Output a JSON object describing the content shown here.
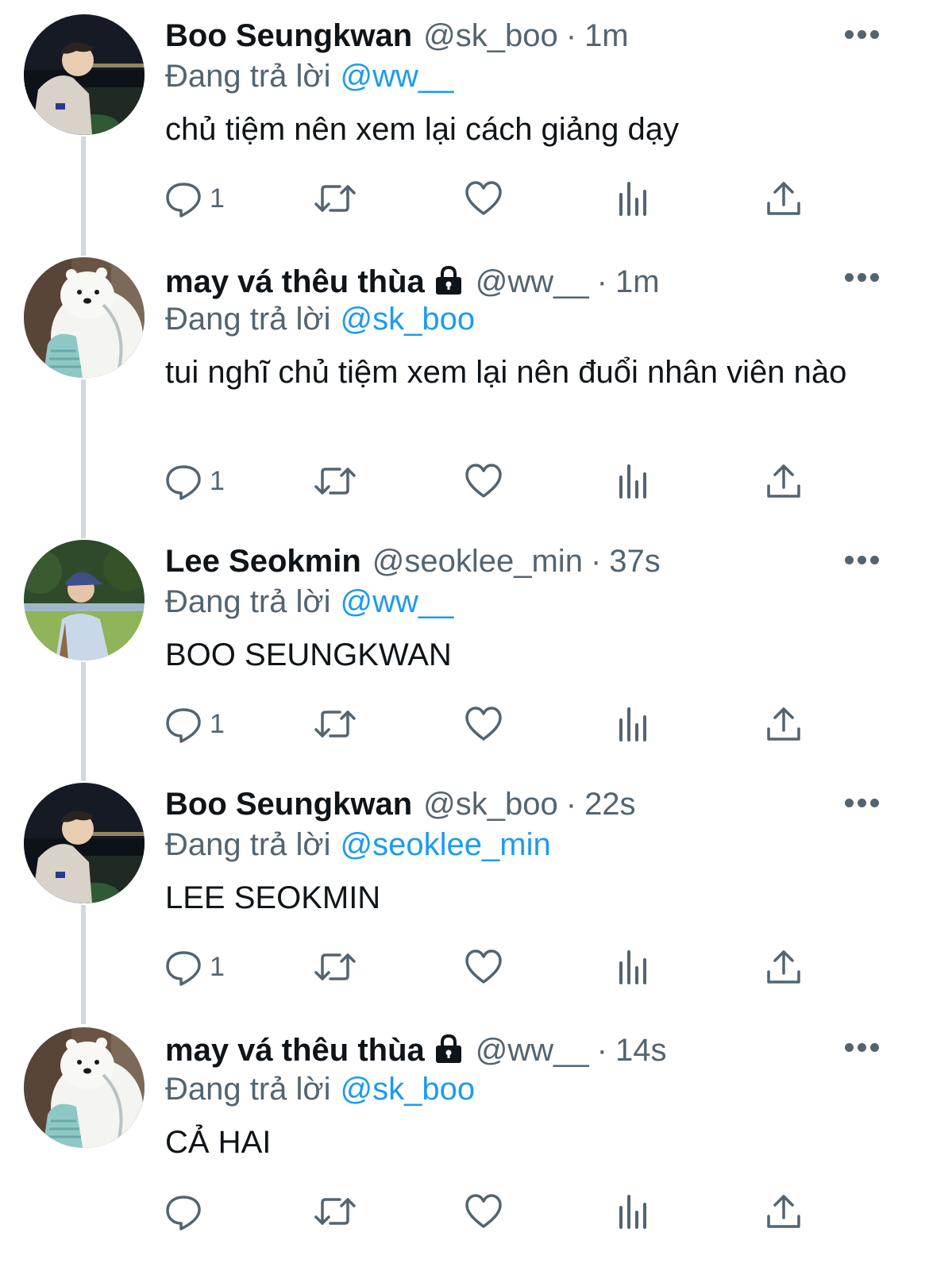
{
  "reply_prefix": "Đang trả lời",
  "tweets": [
    {
      "name": "Boo Seungkwan",
      "handle": "@sk_boo",
      "dot": "·",
      "time": "1m",
      "reply_to": "@ww__",
      "text": "chủ tiệm nên xem lại cách giảng dạy",
      "reply_count": "1",
      "locked": false
    },
    {
      "name": "may vá thêu thùa",
      "handle": "@ww__",
      "dot": "·",
      "time": "1m",
      "reply_to": "@sk_boo",
      "text": "tui nghĩ chủ tiệm xem lại nên đuổi nhân viên nào",
      "reply_count": "1",
      "locked": true
    },
    {
      "name": "Lee Seokmin",
      "handle": "@seoklee_min",
      "dot": "·",
      "time": "37s",
      "reply_to": "@ww__",
      "text": "BOO SEUNGKWAN",
      "reply_count": "1",
      "locked": false
    },
    {
      "name": "Boo Seungkwan",
      "handle": "@sk_boo",
      "dot": "·",
      "time": "22s",
      "reply_to": "@seoklee_min",
      "text": "LEE SEOKMIN",
      "reply_count": "1",
      "locked": false
    },
    {
      "name": "may vá thêu thùa",
      "handle": "@ww__",
      "dot": "·",
      "time": "14s",
      "reply_to": "@sk_boo",
      "text": "CẢ HAI",
      "reply_count": "",
      "locked": true
    }
  ],
  "icons": {
    "reply": "speech-bubble-icon",
    "retweet": "retweet-icon",
    "like": "heart-icon",
    "views": "bar-chart-icon",
    "share": "share-upload-icon",
    "more": "more-dots-icon",
    "lock": "lock-icon"
  },
  "colors": {
    "text": "#0f1419",
    "secondary": "#536471",
    "mention": "#1d9bf0",
    "thread_line": "#cfd9de"
  }
}
